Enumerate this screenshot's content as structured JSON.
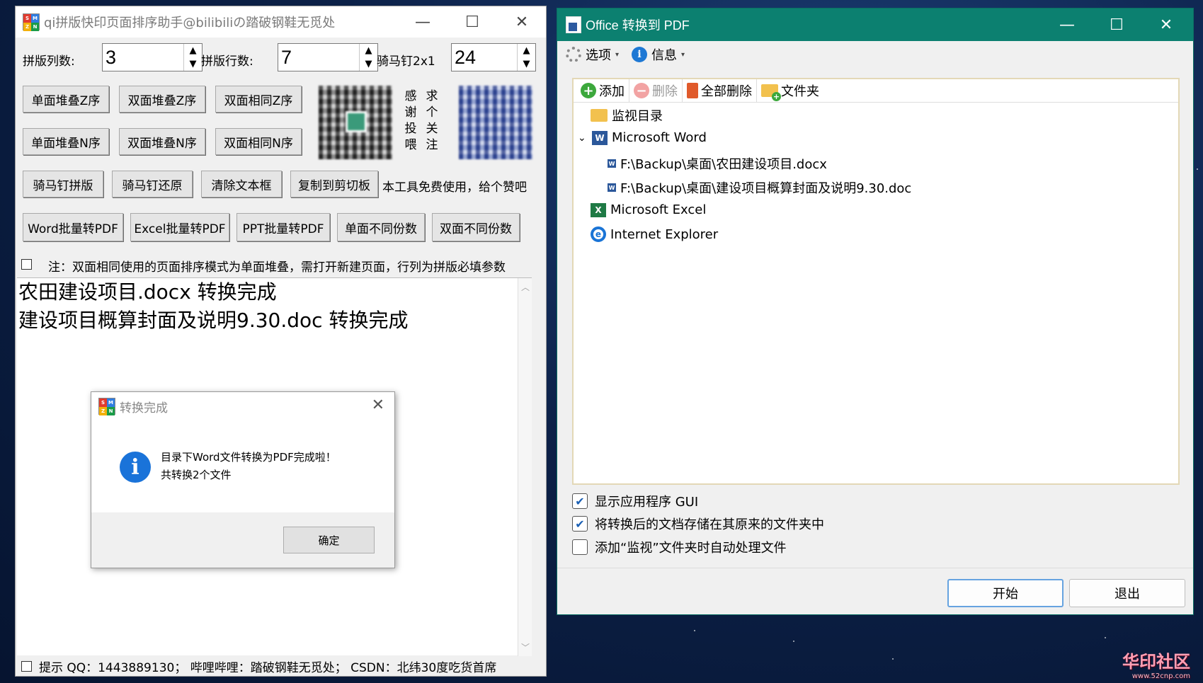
{
  "left_window": {
    "title": "qi拼版快印页面排序助手@bilibiliの踏破钢鞋无觅处",
    "cols_label": "拼版列数:",
    "cols_value": "3",
    "rows_label": "拼版行数:",
    "rows_value": "7",
    "saddle_label": "骑马钉2x1",
    "saddle_value": "24",
    "buttons_row1": [
      "单面堆叠Z序",
      "双面堆叠Z序",
      "双面相同Z序"
    ],
    "buttons_row2": [
      "单面堆叠N序",
      "双面堆叠N序",
      "双面相同N序"
    ],
    "thanks_text": [
      "感",
      "谢",
      "投",
      "喂"
    ],
    "follow_text": [
      "求",
      "个",
      "关",
      "注"
    ],
    "buttons_row3": [
      "骑马钉拼版",
      "骑马钉还原",
      "清除文本框",
      "复制到剪切板"
    ],
    "free_note": "本工具免费使用，给个赞吧",
    "buttons_row4": [
      "Word批量转PDF",
      "Excel批量转PDF",
      "PPT批量转PDF",
      "单面不同份数",
      "双面不同份数"
    ],
    "note": "注：双面相同使用的页面排序模式为单面堆叠，需打开新建页面，行列为拼版必填参数",
    "log_lines": [
      "农田建设项目.docx 转换完成",
      "建设项目概算封面及说明9.30.doc 转换完成"
    ],
    "status_text": "提示 QQ：1443889130； 哔哩哔哩：踏破钢鞋无觅处； CSDN：北纬30度吃货首席"
  },
  "dialog": {
    "title": "转换完成",
    "message_line1": "目录下Word文件转换为PDF完成啦！",
    "message_line2": "共转换2个文件",
    "ok_label": "确定"
  },
  "right_window": {
    "title": "Office 转换到 PDF",
    "menu": [
      "选项",
      "信息"
    ],
    "toolbar": {
      "add": "添加",
      "delete": "删除",
      "delete_all": "全部删除",
      "folder": "文件夹"
    },
    "tree": {
      "watch_dir": "监视目录",
      "word": "Microsoft Word",
      "files": [
        "F:\\Backup\\桌面\\农田建设项目.docx",
        "F:\\Backup\\桌面\\建设项目概算封面及说明9.30.doc"
      ],
      "excel": "Microsoft Excel",
      "ie": "Internet Explorer"
    },
    "options": [
      {
        "label": "显示应用程序 GUI",
        "checked": true
      },
      {
        "label": "将转换后的文档存储在其原来的文件夹中",
        "checked": true
      },
      {
        "label": "添加“监视”文件夹时自动处理文件",
        "checked": false
      }
    ],
    "start_label": "开始",
    "exit_label": "退出"
  },
  "watermark": {
    "text": "华印社区",
    "url": "www.52cnp.com"
  },
  "colors": {
    "accent_teal": "#0c8070",
    "info_blue": "#1a73d9"
  }
}
